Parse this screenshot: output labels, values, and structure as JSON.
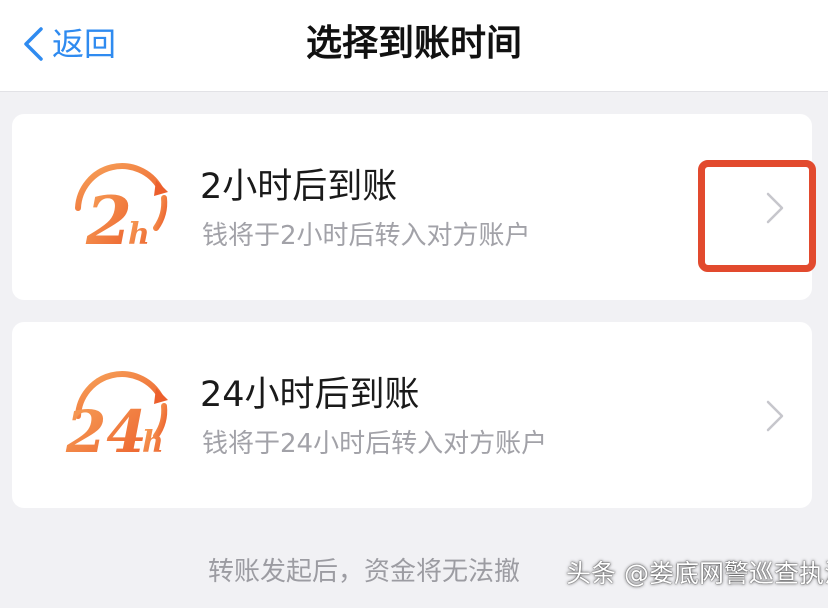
{
  "nav": {
    "back_label": "返回",
    "title": "选择到账时间"
  },
  "options": [
    {
      "badge_number": "2",
      "badge_unit": "h",
      "title": "2小时后到账",
      "subtitle": "钱将于2小时后转入对方账户",
      "icon": "chevron-right-icon"
    },
    {
      "badge_number": "24",
      "badge_unit": "h",
      "title": "24小时后到账",
      "subtitle": "钱将于24小时后转入对方账户",
      "icon": "chevron-right-icon"
    }
  ],
  "footer": {
    "notice": "转账发起后，资金将无法撤",
    "watermark": "头条 @娄底网警巡查执法"
  },
  "colors": {
    "accent_blue": "#2f8bf0",
    "badge_orange": "#f0793a",
    "highlight_red": "#e24a2e"
  }
}
